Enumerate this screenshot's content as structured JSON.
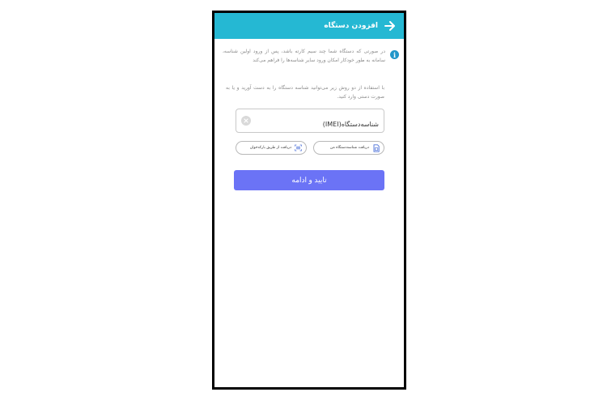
{
  "appbar": {
    "title": "افزودن دستگاه"
  },
  "info": {
    "text": "در صورتی که دستگاه شما چند سیم کارته باشد، پس از ورود اولین شناسه، سامانه به طور خودکار امکان ورود سایر شناسه‌ها را فراهم می‌کند"
  },
  "methods": {
    "text": "با استفاده از دو روش زیر می‌توانید شناسه دستگاه را به دست آورید و یا به صورت دستی وارد کنید."
  },
  "imei_field": {
    "label": "شناسه‌دستگاه(IMEI)"
  },
  "chips": {
    "get_device_id": "دریافت شناسه‌دستگاه من",
    "scan_barcode": "دریافت از طریق بارکدخوان"
  },
  "confirm": {
    "label": "تایید و ادامه"
  },
  "colors": {
    "appbar": "#25b8d3",
    "primary_button": "#6b73f6",
    "info_icon": "#2196c9"
  }
}
